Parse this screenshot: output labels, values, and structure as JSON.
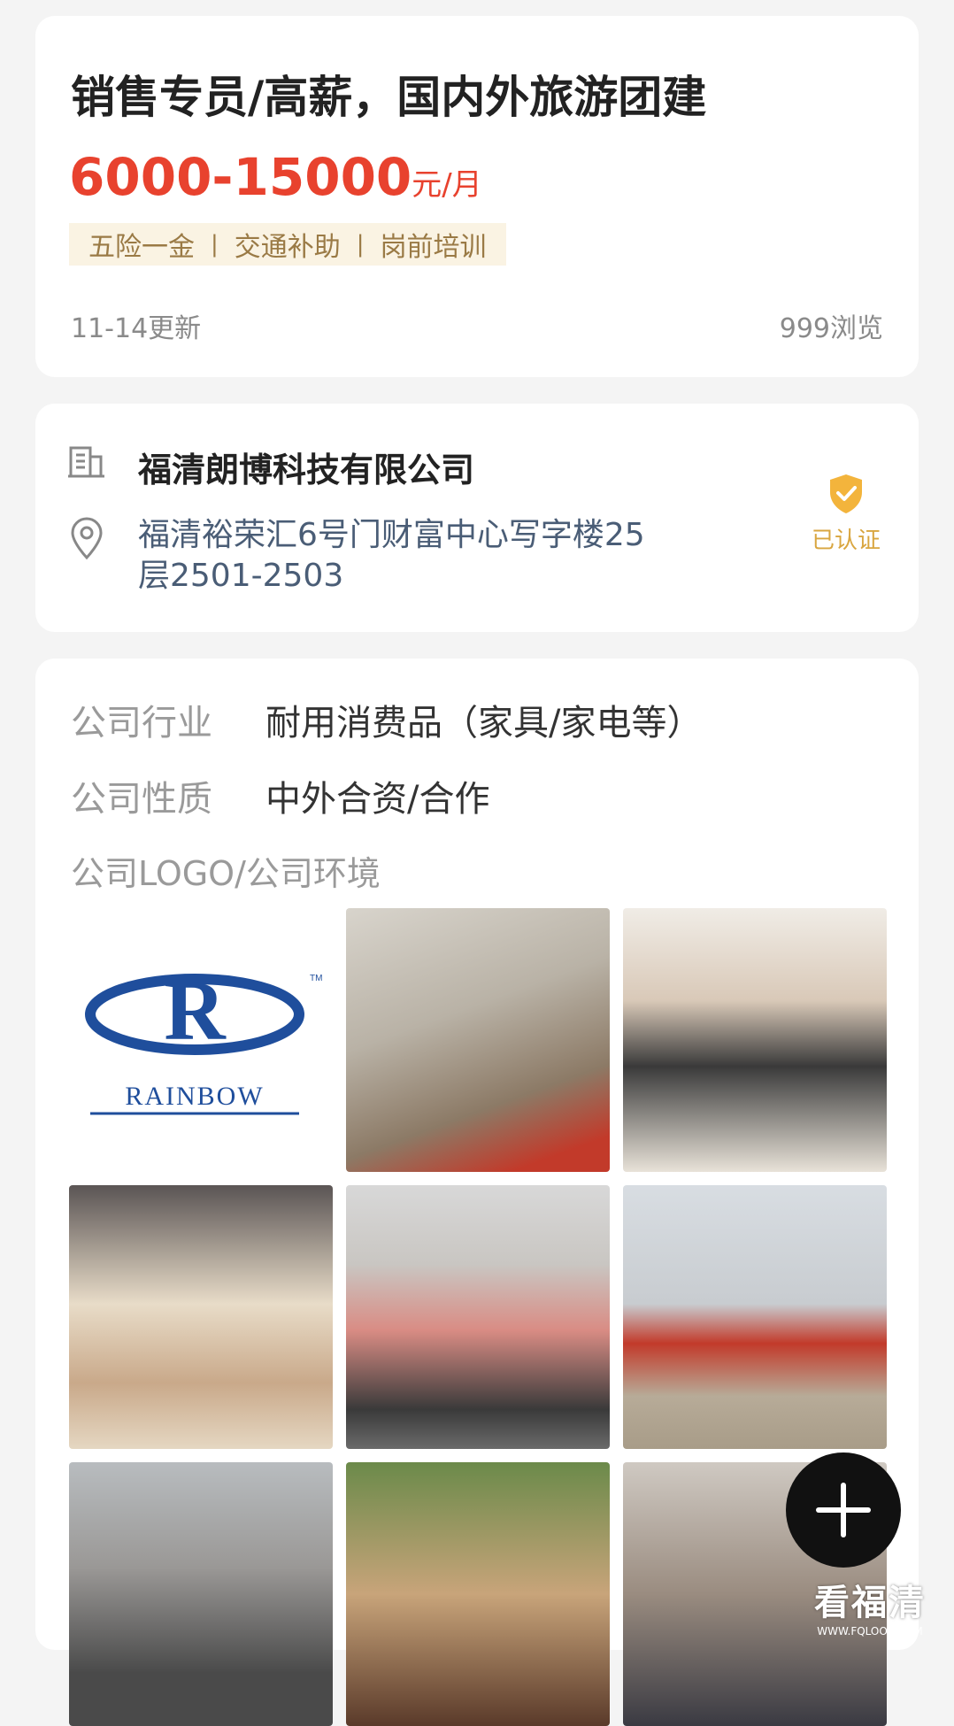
{
  "job": {
    "title": "销售专员/高薪，国内外旅游团建",
    "salary": "6000-15000",
    "salary_unit": "元/月",
    "benefits": [
      "五险一金",
      "交通补助",
      "岗前培训"
    ],
    "separator": "|",
    "updated": "11-14更新",
    "views": "999浏览"
  },
  "company": {
    "name": "福清朗博科技有限公司",
    "address": "福清裕荣汇6号门财富中心写字楼25层2501-2503",
    "verified_label": "已认证",
    "building_icon": "building-icon",
    "location_icon": "location-pin-icon",
    "verified_icon": "verified-shield-icon"
  },
  "info": {
    "industry_label": "公司行业",
    "industry_value": "耐用消费品（家具/家电等）",
    "nature_label": "公司性质",
    "nature_value": "中外合资/合作",
    "gallery_label": "公司LOGO/公司环境"
  },
  "logo": {
    "brand": "RAINBOW",
    "tm": "TM",
    "mark": "R"
  },
  "gallery": [
    "company-logo",
    "office-photo-wall",
    "office-reception",
    "office-dining-area",
    "team-celebration",
    "outdoor-team-trip",
    "airport-group-photo",
    "team-dinner",
    "business-meeting"
  ],
  "fab": {
    "icon": "plus-icon"
  },
  "watermark": {
    "main": "看福清",
    "sub": "WWW.FQLOOK.COM"
  },
  "colors": {
    "accent_red": "#e8422e",
    "benefit_text": "#9a7a45",
    "benefit_bg": "#faf3e3",
    "verified": "#f3b43c",
    "address_text": "#4a5d76"
  }
}
